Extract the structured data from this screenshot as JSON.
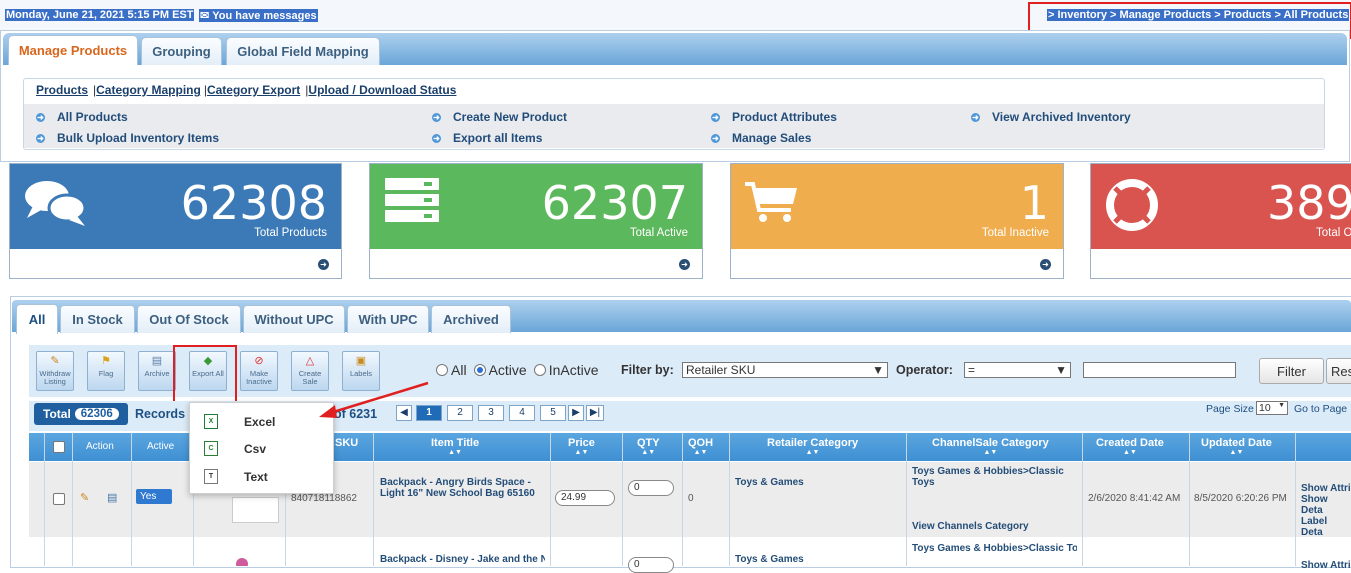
{
  "top": {
    "date": "Monday, June 21, 2021 5:15 PM EST",
    "messages": "You have messages",
    "breadcrumb": "> Inventory > Manage Products > Products > All Products"
  },
  "main_tabs": [
    "Manage Products",
    "Grouping",
    "Global Field Mapping"
  ],
  "sub_links": [
    "Products",
    "Category Mapping",
    "Category Export",
    "Upload / Download Status"
  ],
  "sub_separators": [
    "|",
    "|",
    "|"
  ],
  "quick_links": [
    "All Products",
    "Create New Product",
    "Product Attributes",
    "View Archived Inventory",
    "Bulk Upload Inventory Items",
    "Export all Items",
    "Manage Sales"
  ],
  "stats": [
    {
      "value": "62308",
      "label": "Total Products",
      "color": "#3c7ab7",
      "icon": "comments-icon"
    },
    {
      "value": "62307",
      "label": "Total Active",
      "color": "#5cb85c",
      "icon": "server-icon"
    },
    {
      "value": "1",
      "label": "Total Inactive",
      "color": "#f0ad4e",
      "icon": "cart-icon"
    },
    {
      "value": "389",
      "label": "Total O",
      "color": "#d9534f",
      "icon": "lifebuoy-icon"
    }
  ],
  "filter_tabs": [
    "All",
    "In Stock",
    "Out Of Stock",
    "Without UPC",
    "With UPC",
    "Archived"
  ],
  "tools": [
    {
      "label": "Withdraw Listing",
      "icon": "pencil-icon"
    },
    {
      "label": "Flag",
      "icon": "flag-icon"
    },
    {
      "label": "Archive",
      "icon": "archive-icon"
    },
    {
      "label": "Export All",
      "icon": "export-icon"
    },
    {
      "label": "Make Inactive",
      "icon": "ban-icon"
    },
    {
      "label": "Create Sale",
      "icon": "basket-icon"
    },
    {
      "label": "Labels",
      "icon": "label-icon"
    }
  ],
  "status_options": [
    "All",
    "Active",
    "InActive"
  ],
  "status_selected": "Active",
  "filter_by_label": "Filter by:",
  "filter_by_value": "Retailer SKU",
  "operator_label": "Operator:",
  "operator_value": "=",
  "filter_button": "Filter",
  "reset_button": "Res",
  "total_label": "Total",
  "total_count": "62306",
  "records_label": "Records",
  "records_of": "of 6231",
  "pages": [
    "1",
    "2",
    "3",
    "4",
    "5"
  ],
  "page_size_label": "Page Size",
  "page_size_value": "10",
  "go_to_page_label": "Go to Page",
  "export_menu": [
    "Excel",
    "Csv",
    "Text"
  ],
  "columns": [
    "Action",
    "Active",
    "SKU",
    "Item Title",
    "Price",
    "QTY",
    "QOH",
    "Retailer Category",
    "ChannelSale Category",
    "Created Date",
    "Updated Date"
  ],
  "rows": [
    {
      "active": "Yes",
      "sku": "840718118862",
      "title": "Backpack - Angry Birds Space - Light 16\" New School Bag 65160",
      "price": "24.99",
      "qty": "0",
      "qoh": "0",
      "retailer_category": "Toys & Games",
      "channel_category": "Toys Games & Hobbies>Classic Toys",
      "view_channels": "View Channels Category",
      "created": "2/6/2020 8:41:42 AM",
      "updated": "8/5/2020 6:20:26 PM",
      "links": [
        "Show Attri",
        "Show Deta",
        "Label Deta"
      ]
    },
    {
      "title": "Backpack - Disney - Jake and the N",
      "qty": "0",
      "retailer_category": "Toys & Games",
      "channel_category": "Toys Games & Hobbies>Classic To",
      "links": [
        "Show Attri"
      ]
    }
  ]
}
